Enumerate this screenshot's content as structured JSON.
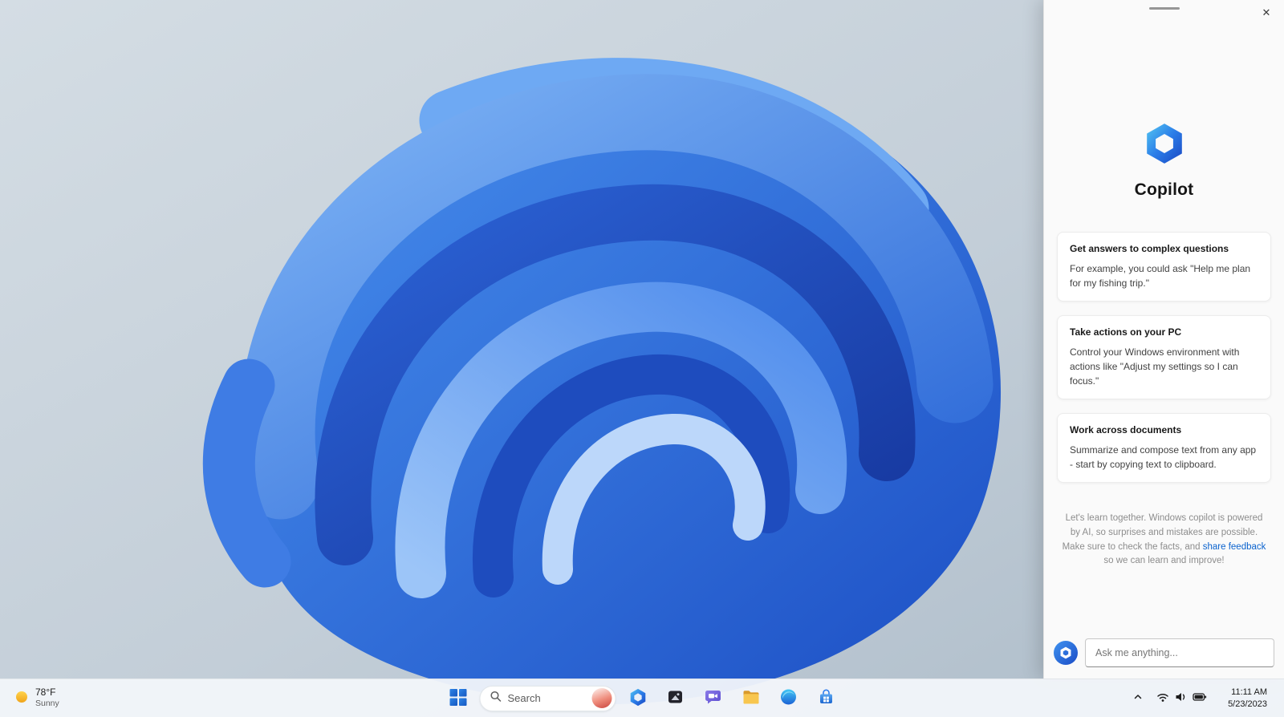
{
  "desktop": {
    "wallpaper_name": "windows-11-bloom-blue"
  },
  "colors": {
    "accent": "#0b63ce",
    "panel_bg": "#fafafa",
    "taskbar_bg": "#f2f6fa",
    "copilot_gradient_start": "#53c7f2",
    "copilot_gradient_end": "#1946c2"
  },
  "taskbar": {
    "weather": {
      "temp": "78°F",
      "condition": "Sunny"
    },
    "search": {
      "placeholder": "Search"
    },
    "apps": [
      "windows-start",
      "search",
      "copilot",
      "photos",
      "teams-chat",
      "file-explorer",
      "edge",
      "microsoft-store"
    ],
    "tray_icons": [
      "chevron-up",
      "wifi",
      "volume",
      "battery"
    ],
    "clock": {
      "time": "11:11 AM",
      "date": "5/23/2023"
    }
  },
  "copilot": {
    "title": "Copilot",
    "controls": {
      "close": "✕"
    },
    "cards": [
      {
        "title": "Get answers to complex questions",
        "body": "For example, you could ask \"Help me plan for my fishing trip.\""
      },
      {
        "title": "Take actions on your PC",
        "body": "Control your Windows environment with actions like \"Adjust my settings so I can focus.\""
      },
      {
        "title": "Work across documents",
        "body": "Summarize and compose text from any app - start by copying text to clipboard."
      }
    ],
    "disclaimer": {
      "text_before": "Let's learn together. Windows copilot is powered by AI, so surprises and mistakes are possible. Make sure to check the facts, and ",
      "link": "share feedback",
      "text_after": " so we can learn and improve!"
    },
    "input_placeholder": "Ask me anything..."
  }
}
